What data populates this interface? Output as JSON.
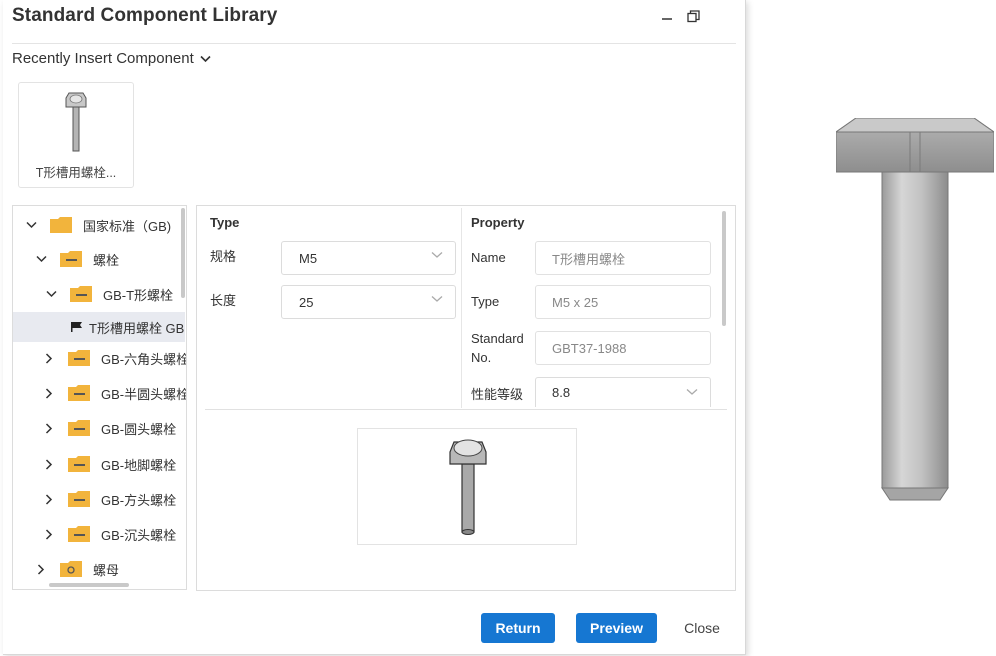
{
  "dialog": {
    "title": "Standard Component Library",
    "recent_label": "Recently Insert Component",
    "recent_items": [
      {
        "caption": "T形槽用螺栓..."
      }
    ]
  },
  "tree": {
    "items": [
      {
        "label": "国家标准（GB)",
        "expanded": true,
        "icon": "folder-icon"
      },
      {
        "label": "螺栓",
        "expanded": true,
        "icon": "folder-icon"
      },
      {
        "label": "GB-T形螺栓",
        "expanded": true,
        "icon": "folder-icon"
      },
      {
        "label": "T形槽用螺栓 GB",
        "selected": true,
        "icon": "flag-icon"
      },
      {
        "label": "GB-六角头螺栓",
        "expanded": false,
        "icon": "folder-icon"
      },
      {
        "label": "GB-半圆头螺栓",
        "expanded": false,
        "icon": "folder-icon"
      },
      {
        "label": "GB-圆头螺栓",
        "expanded": false,
        "icon": "folder-icon"
      },
      {
        "label": "GB-地脚螺栓",
        "expanded": false,
        "icon": "folder-icon"
      },
      {
        "label": "GB-方头螺栓",
        "expanded": false,
        "icon": "folder-icon"
      },
      {
        "label": "GB-沉头螺栓",
        "expanded": false,
        "icon": "folder-icon"
      },
      {
        "label": "螺母",
        "expanded": false,
        "icon": "folder-icon"
      }
    ]
  },
  "type_section": {
    "heading": "Type",
    "fields": [
      {
        "label": "规格",
        "value": "M5"
      },
      {
        "label": "长度",
        "value": "25"
      }
    ]
  },
  "property_section": {
    "heading": "Property",
    "name_label": "Name",
    "name_value": "T形槽用螺栓",
    "type_label": "Type",
    "type_value": "M5 x 25",
    "std_label_1": "Standard",
    "std_label_2": "No.",
    "std_value": "GBT37-1988",
    "grade_label": "性能等级",
    "grade_value": "8.8"
  },
  "buttons": {
    "return": "Return",
    "preview": "Preview",
    "close": "Close"
  },
  "colors": {
    "primary": "#1677d2",
    "folder": "#f2b43c",
    "selected_row": "#e8eaf0"
  }
}
